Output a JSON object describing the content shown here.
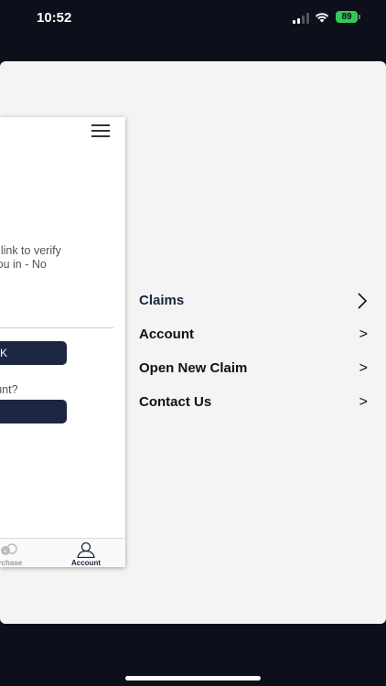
{
  "status_bar": {
    "time": "10:52",
    "battery": "89"
  },
  "background_screen": {
    "verify_text": "eive a link to verify\nsign you in - No",
    "link_button_label": "K",
    "question_text": "count?",
    "tabbar": {
      "purchase_label": "y purchase",
      "account_label": "Account"
    }
  },
  "menu": {
    "items": [
      {
        "label": "Claims",
        "chevron": ">"
      },
      {
        "label": "Account",
        "chevron": ">"
      },
      {
        "label": "Open New Claim",
        "chevron": ">"
      },
      {
        "label": "Contact Us",
        "chevron": ">"
      }
    ]
  },
  "colors": {
    "primary": "#1c2541",
    "sheet_background": "#f4f4f4",
    "battery": "#34c759"
  }
}
